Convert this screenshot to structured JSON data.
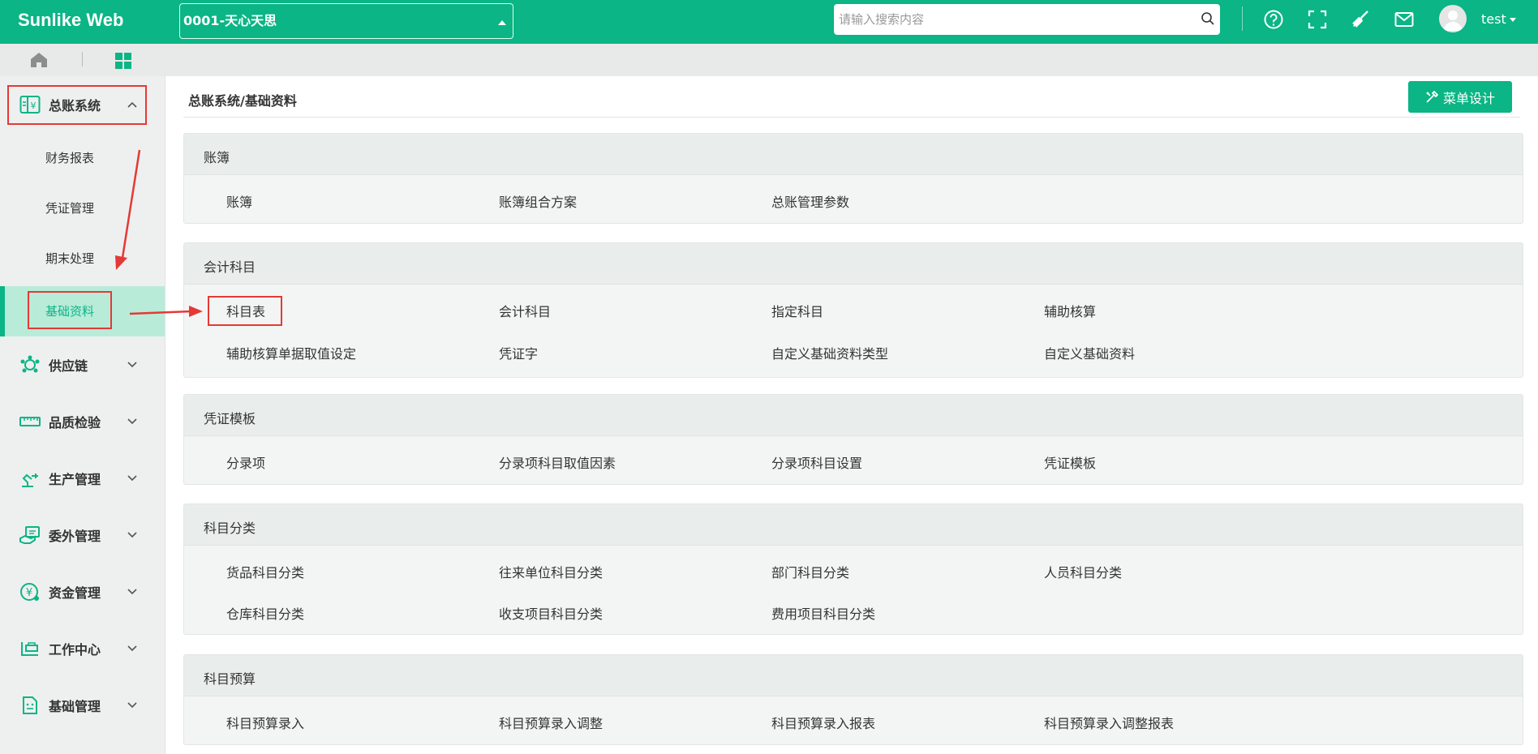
{
  "app": {
    "title": "Sunlike Web"
  },
  "header": {
    "company": "0001-天心天思",
    "search_placeholder": "请输入搜索内容",
    "user": "test",
    "icons": [
      "help-icon",
      "fullscreen-icon",
      "broom-icon",
      "mail-icon",
      "avatar-icon"
    ]
  },
  "sidebar": {
    "groups": [
      {
        "label": "总账系统",
        "icon": "ledger-icon",
        "expanded": true
      },
      {
        "label": "供应链",
        "icon": "supply-chain-icon"
      },
      {
        "label": "品质检验",
        "icon": "ruler-icon"
      },
      {
        "label": "生产管理",
        "icon": "robot-arm-icon"
      },
      {
        "label": "委外管理",
        "icon": "outsource-icon"
      },
      {
        "label": "资金管理",
        "icon": "yen-icon"
      },
      {
        "label": "工作中心",
        "icon": "workbench-icon"
      },
      {
        "label": "基础管理",
        "icon": "document-icon"
      }
    ],
    "sub_items": [
      "财务报表",
      "凭证管理",
      "期末处理",
      "基础资料"
    ],
    "active_sub": "基础资料"
  },
  "main": {
    "breadcrumb": "总账系统/基础资料",
    "design_button": "菜单设计",
    "sections": [
      {
        "title": "账簿",
        "items": [
          "账簿",
          "账簿组合方案",
          "总账管理参数"
        ]
      },
      {
        "title": "会计科目",
        "items": [
          "科目表",
          "会计科目",
          "指定科目",
          "辅助核算",
          "辅助核算单据取值设定",
          "凭证字",
          "自定义基础资料类型",
          "自定义基础资料"
        ]
      },
      {
        "title": "凭证模板",
        "items": [
          "分录项",
          "分录项科目取值因素",
          "分录项科目设置",
          "凭证模板"
        ]
      },
      {
        "title": "科目分类",
        "items": [
          "货品科目分类",
          "往来单位科目分类",
          "部门科目分类",
          "人员科目分类",
          "仓库科目分类",
          "收支项目科目分类",
          "费用项目科目分类"
        ]
      },
      {
        "title": "科目预算",
        "items": [
          "科目预算录入",
          "科目预算录入调整",
          "科目预算录入报表",
          "科目预算录入调整报表"
        ]
      }
    ]
  },
  "colors": {
    "brand": "#0bb585",
    "annotation": "#e53935",
    "active_bg": "#b9ebd9"
  }
}
